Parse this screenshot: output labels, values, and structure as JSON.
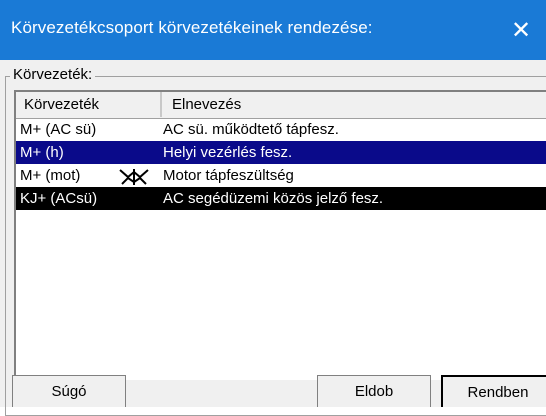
{
  "window": {
    "title": "Körvezetékcsoport körvezetékeinek rendezése:",
    "close_icon": "close-icon"
  },
  "group": {
    "label": "Körvezeték:"
  },
  "table": {
    "columns": [
      "Körvezeték",
      "Elnevezés"
    ],
    "rows": [
      {
        "code": "M+ (AC sü)",
        "name": "AC sü. működtető tápfesz.",
        "state": "normal"
      },
      {
        "code": "M+ (h)",
        "name": "Helyi vezérlés fesz.",
        "state": "selected"
      },
      {
        "code": "M+ (mot)",
        "name": "Motor tápfeszültség",
        "state": "normal",
        "icon": "drag-move-icon"
      },
      {
        "code": "KJ+ (ACsü)",
        "name": "AC segédüzemi közös jelző fesz.",
        "state": "highlighted"
      }
    ]
  },
  "buttons": {
    "help": "Súgó",
    "discard": "Eldob",
    "ok": "Rendben"
  },
  "colors": {
    "titlebar": "#1a7ad6",
    "selected_row": "#0a0a8a",
    "highlighted_row": "#000000"
  }
}
